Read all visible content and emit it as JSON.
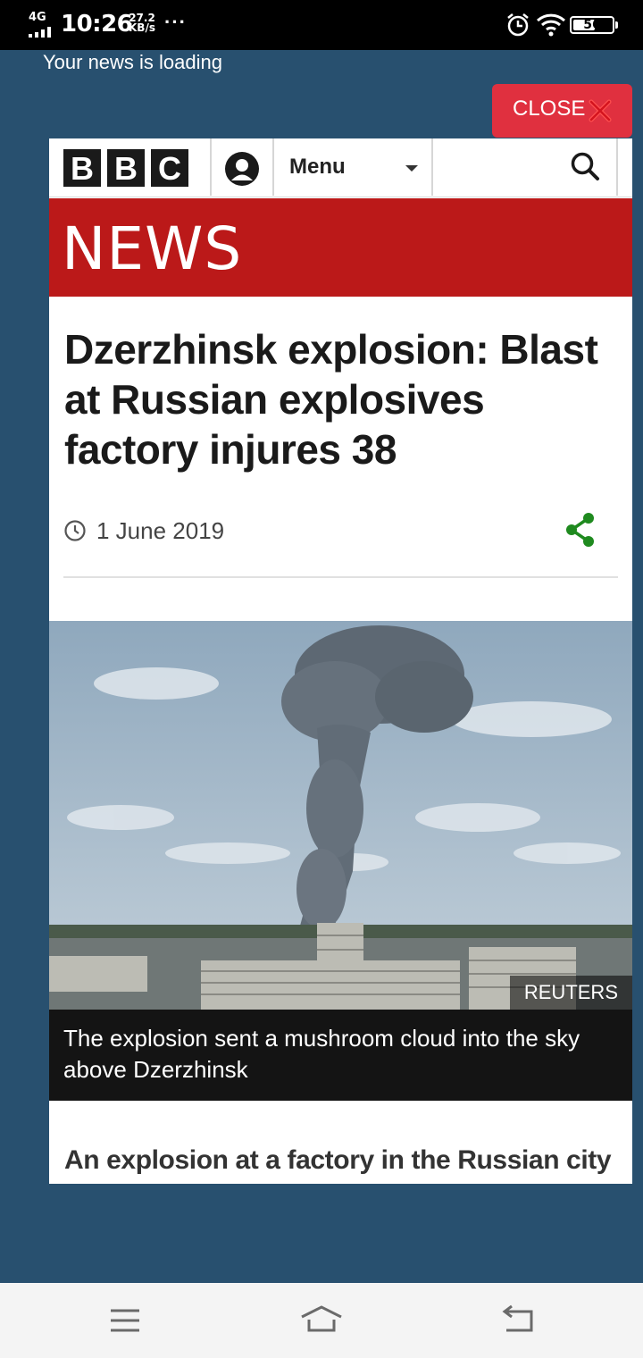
{
  "status_bar": {
    "network": "4G",
    "time": "10:26",
    "speed_value": "27.2",
    "speed_unit": "KB/s",
    "more": "···",
    "battery": "56",
    "battery_level": 0.56
  },
  "overlay": {
    "loading_text": "Your news is loading",
    "close_label": "CLOSE"
  },
  "bbc_header": {
    "logo_letters": [
      "B",
      "B",
      "C"
    ],
    "menu_label": "Menu",
    "news_banner": "NEWS"
  },
  "article": {
    "headline": "Dzerzhinsk explosion: Blast at Russian explosives factory injures 38",
    "date": "1 June 2019",
    "image_credit": "REUTERS",
    "image_caption": "The explosion sent a mushroom cloud into the sky above Dzerzhinsk",
    "lead": "An explosion at a factory in the Russian city"
  },
  "icons": {
    "close": "close-x-icon",
    "account": "account-icon",
    "search": "search-icon",
    "clock": "clock-icon",
    "share": "share-icon",
    "nav_menu": "nav-menu-icon",
    "nav_home": "nav-home-icon",
    "nav_back": "nav-back-icon"
  },
  "colors": {
    "overlay_background": "#28506f",
    "close_button": "#e0303f",
    "news_banner": "#bb1919",
    "share_icon": "#1f8a1f",
    "caption_background": "#141414"
  }
}
